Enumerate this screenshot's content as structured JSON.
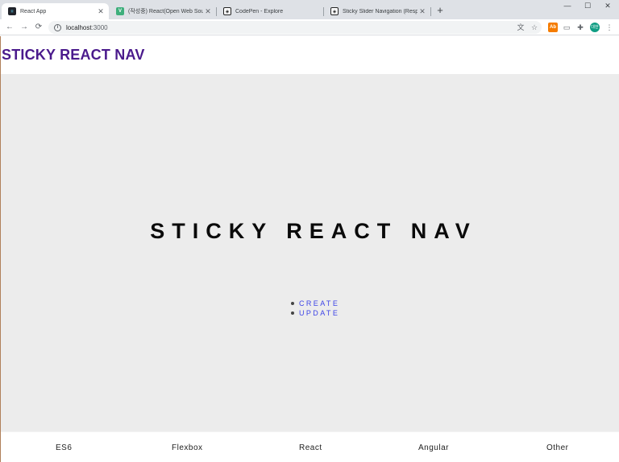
{
  "browser": {
    "tabs": [
      {
        "title": "React App",
        "active": true,
        "icon": "react-icon"
      },
      {
        "title": "(작성중) React(Open Web Sour",
        "active": false,
        "icon": "v-icon",
        "icon_label": "V"
      },
      {
        "title": "CodePen - Explore",
        "active": false,
        "icon": "codepen-icon"
      },
      {
        "title": "Sticky Slider Navigation (Respo",
        "active": false,
        "icon": "codepen-icon"
      }
    ],
    "url_host": "localhost",
    "url_port": ":3000",
    "extension_label": "Ab",
    "avatar_label": "대한"
  },
  "site": {
    "brand": "STICKY REACT NAV",
    "hero_title": "STICKY REACT NAV",
    "hero_menu": [
      "CREATE",
      "UPDATE"
    ],
    "bottom_nav": [
      "ES6",
      "Flexbox",
      "React",
      "Angular",
      "Other"
    ]
  },
  "colors": {
    "brand": "#4a1a8c",
    "link": "#3d44e6",
    "hero_bg": "#ececec"
  }
}
